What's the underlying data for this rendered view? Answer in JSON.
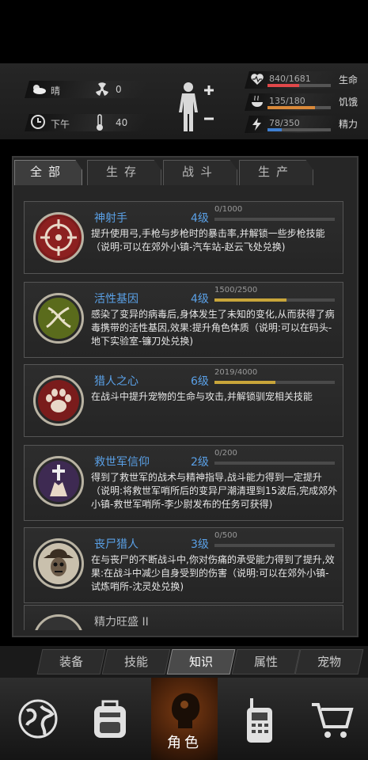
{
  "status": {
    "weather": "晴",
    "radiation": "0",
    "time_of_day": "下午",
    "temperature": "40",
    "stats": [
      {
        "label": "生命",
        "value": "840/1681",
        "current": 840,
        "max": 1681,
        "color": "#e0484a"
      },
      {
        "label": "饥饿",
        "value": "135/180",
        "current": 135,
        "max": 180,
        "color": "#d9893a"
      },
      {
        "label": "精力",
        "value": "78/350",
        "current": 78,
        "max": 350,
        "color": "#3f7fd0"
      }
    ]
  },
  "tabs": [
    {
      "label": "全部",
      "active": true
    },
    {
      "label": "生存",
      "active": false
    },
    {
      "label": "战斗",
      "active": false
    },
    {
      "label": "生产",
      "active": false
    }
  ],
  "skills": [
    {
      "name": "神射手",
      "level": "4级",
      "progress": "0/1000",
      "current": 0,
      "max": 1000,
      "icon": "crosshair-icon",
      "desc": "提升使用弓,手枪与步枪时的暴击率,并解锁一些步枪技能（说明:可以在郊外小镇-汽车站-赵云飞处兑换)"
    },
    {
      "name": "活性基因",
      "level": "4级",
      "progress": "1500/2500",
      "current": 1500,
      "max": 2500,
      "icon": "dna-icon",
      "desc": "感染了变异的病毒后,身体发生了未知的变化,从而获得了病毒携带的活性基因,效果:提升角色体质（说明:可以在码头-地下实验室-镰刀处兑换)"
    },
    {
      "name": "猎人之心",
      "level": "6级",
      "progress": "2019/4000",
      "current": 2019,
      "max": 4000,
      "icon": "paw-icon",
      "desc": "在战斗中提升宠物的生命与攻击,并解锁驯宠相关技能"
    },
    {
      "name": "救世军信仰",
      "level": "2级",
      "progress": "0/200",
      "current": 0,
      "max": 200,
      "icon": "praying-cross-icon",
      "desc": "得到了救世军的战术与精神指导,战斗能力得到一定提升（说明:将救世军哨所后的变异尸潮清理到15波后,完成郊外小镇-救世军哨所-李少尉发布的任务可获得)"
    },
    {
      "name": "丧尸猎人",
      "level": "3级",
      "progress": "0/500",
      "current": 0,
      "max": 500,
      "icon": "zombie-hunter-icon",
      "desc": "在与丧尸的不断战斗中,你对伤痛的承受能力得到了提升,效果:在战斗中减少自身受到的伤害（说明:可以在郊外小镇-试炼哨所-沈灵处兑换)"
    },
    {
      "name": "精力旺盛 II",
      "level": "",
      "progress": "",
      "current": 0,
      "max": 1,
      "icon": "energy-icon",
      "desc": ""
    }
  ],
  "sub_tabs": [
    {
      "label": "装备",
      "active": false
    },
    {
      "label": "技能",
      "active": false
    },
    {
      "label": "知识",
      "active": true
    },
    {
      "label": "属性",
      "active": false
    },
    {
      "label": "宠物",
      "active": false
    }
  ],
  "nav": [
    {
      "icon": "globe-icon",
      "label": ""
    },
    {
      "icon": "backpack-icon",
      "label": ""
    },
    {
      "icon": "character-head-icon",
      "label": "角色",
      "active": true
    },
    {
      "icon": "radio-icon",
      "label": ""
    },
    {
      "icon": "shopping-cart-icon",
      "label": ""
    }
  ]
}
